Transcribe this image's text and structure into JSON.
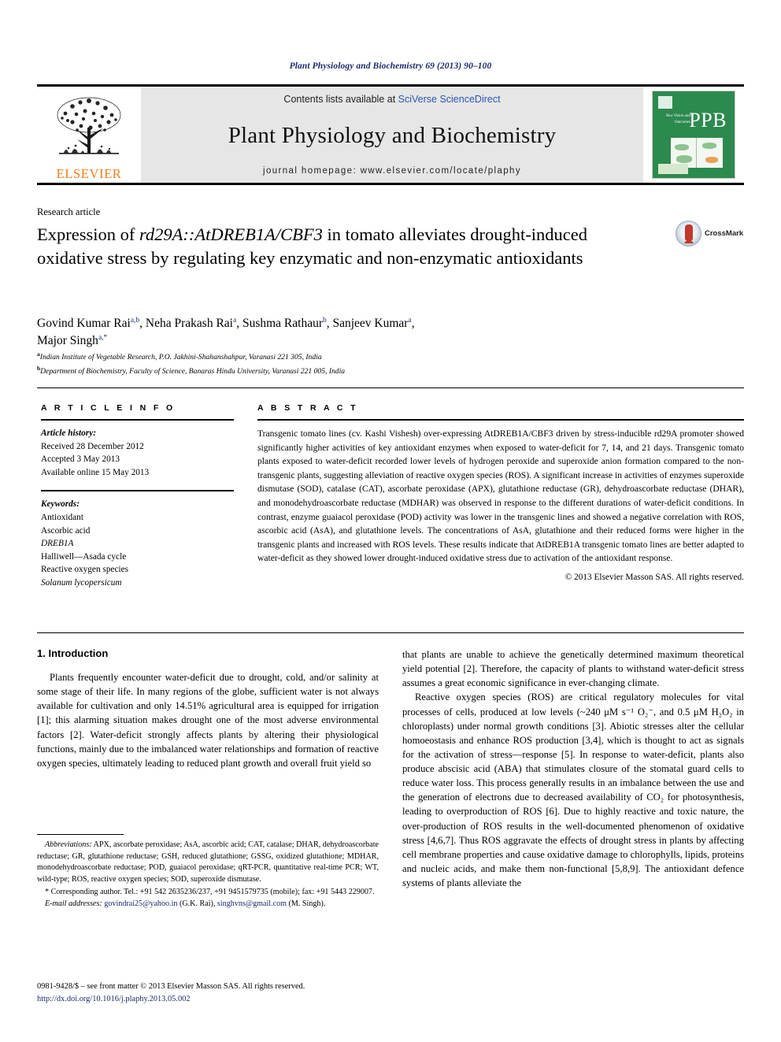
{
  "running_head": "Plant Physiology and Biochemistry 69 (2013) 90–100",
  "masthead": {
    "publisher_name": "ELSEVIER",
    "contents_prefix": "Contents lists available at ",
    "contents_link": "SciVerse ScienceDirect",
    "journal_title": "Plant Physiology and Biochemistry",
    "homepage_line": "journal homepage: www.elsevier.com/locate/plaphy",
    "cover_abbrev": "PPB",
    "cover_tagline": "New Vision and Outcomes"
  },
  "article": {
    "section_type": "Research article",
    "title_parts": [
      {
        "text": "Expression of ",
        "italic": false
      },
      {
        "text": "rd29A::AtDREB1A/CBF3",
        "italic": true
      },
      {
        "text": " in tomato alleviates drought-induced oxidative stress by regulating key enzymatic and non-enzymatic antioxidants",
        "italic": false
      }
    ],
    "title_plain": "Expression of rd29A::AtDREB1A/CBF3 in tomato alleviates drought-induced oxidative stress by regulating key enzymatic and non-enzymatic antioxidants",
    "crossmark_label": "CrossMark",
    "authors": [
      {
        "name": "Govind Kumar Rai",
        "sup": "a,b",
        "sep": ", "
      },
      {
        "name": "Neha Prakash Rai",
        "sup": "a",
        "sep": ", "
      },
      {
        "name": "Sushma Rathaur",
        "sup": "b",
        "sep": ", "
      },
      {
        "name": "Sanjeev Kumar",
        "sup": "a",
        "sep": ","
      },
      {
        "name": "Major Singh",
        "sup": "a,*",
        "sep": ""
      }
    ],
    "affiliations": [
      {
        "marker": "a",
        "text": "Indian Institute of Vegetable Research, P.O. Jakhini-Shahanshahpur, Varanasi 221 305, India"
      },
      {
        "marker": "b",
        "text": "Department of Biochemistry, Faculty of Science, Banaras Hindu University, Varanasi 221 005, India"
      }
    ]
  },
  "article_info": {
    "heading": "A R T I C L E  I N F O",
    "history_label": "Article history:",
    "history": [
      "Received 28 December 2012",
      "Accepted 3 May 2013",
      "Available online 15 May 2013"
    ],
    "keywords_label": "Keywords:",
    "keywords": [
      {
        "text": "Antioxidant",
        "italic": false
      },
      {
        "text": "Ascorbic acid",
        "italic": false
      },
      {
        "text": "DREB1A",
        "italic": true
      },
      {
        "text": "Halliwell—Asada cycle",
        "italic": false
      },
      {
        "text": "Reactive oxygen species",
        "italic": false
      },
      {
        "text": "Solanum lycopersicum",
        "italic": true
      }
    ]
  },
  "abstract": {
    "heading": "A B S T R A C T",
    "text": "Transgenic tomato lines (cv. Kashi Vishesh) over-expressing AtDREB1A/CBF3 driven by stress-inducible rd29A promoter showed significantly higher activities of key antioxidant enzymes when exposed to water-deficit for 7, 14, and 21 days. Transgenic tomato plants exposed to water-deficit recorded lower levels of hydrogen peroxide and superoxide anion formation compared to the non-transgenic plants, suggesting alleviation of reactive oxygen species (ROS). A significant increase in activities of enzymes superoxide dismutase (SOD), catalase (CAT), ascorbate peroxidase (APX), glutathione reductase (GR), dehydroascorbate reductase (DHAR), and monodehydroascorbate reductase (MDHAR) was observed in response to the different durations of water-deficit conditions. In contrast, enzyme guaiacol peroxidase (POD) activity was lower in the transgenic lines and showed a negative correlation with ROS, ascorbic acid (AsA), and glutathione levels. The concentrations of AsA, glutathione and their reduced forms were higher in the transgenic plants and increased with ROS levels. These results indicate that AtDREB1A transgenic tomato lines are better adapted to water-deficit as they showed lower drought-induced oxidative stress due to activation of the antioxidant response.",
    "copyright": "© 2013 Elsevier Masson SAS. All rights reserved."
  },
  "introduction": {
    "heading": "1.  Introduction",
    "left_p1": "Plants frequently encounter water-deficit due to drought, cold, and/or salinity at some stage of their life. In many regions of the globe, sufficient water is not always available for cultivation and only 14.51% agricultural area is equipped for irrigation [1]; this alarming situation makes drought one of the most adverse environmental factors [2]. Water-deficit strongly affects plants by altering their physiological functions, mainly due to the imbalanced water relationships and formation of reactive oxygen species, ultimately leading to reduced plant growth and overall fruit yield so",
    "right_p1": "that plants are unable to achieve the genetically determined maximum theoretical yield potential [2]. Therefore, the capacity of plants to withstand water-deficit stress assumes a great economic significance in ever-changing climate.",
    "right_p2": "Reactive oxygen species (ROS) are critical regulatory molecules for vital processes of cells, produced at low levels (~240 μM s⁻¹ O₂⁻, and 0.5 μM H₂O₂ in chloroplasts) under normal growth conditions [3]. Abiotic stresses alter the cellular homoeostasis and enhance ROS production [3,4], which is thought to act as signals for the activation of stress—response [5]. In response to water-deficit, plants also produce abscisic acid (ABA) that stimulates closure of the stomatal guard cells to reduce water loss. This process generally results in an imbalance between the use and the generation of electrons due to decreased availability of CO₂ for photosynthesis, leading to overproduction of ROS [6]. Due to highly reactive and toxic nature, the over-production of ROS results in the well-documented phenomenon of oxidative stress [4,6,7]. Thus ROS aggravate the effects of drought stress in plants by affecting cell membrane properties and cause oxidative damage to chlorophylls, lipids, proteins and nucleic acids, and make them non-functional [5,8,9]. The antioxidant defence systems of plants alleviate the"
  },
  "footnotes": {
    "abbreviations_label": "Abbreviations:",
    "abbreviations_text": " APX, ascorbate peroxidase; AsA, ascorbic acid; CAT, catalase; DHAR, dehydroascorbate reductase; GR, glutathione reductase; GSH, reduced glutathione; GSSG, oxidized glutathione; MDHAR, monodehydroascorbate reductase; POD, guaiacol peroxidase; qRT-PCR, quantitative real-time PCR; WT, wild-type; ROS, reactive oxygen species; SOD, superoxide dismutase.",
    "corresponding_text": "* Corresponding author. Tel.: +91 542 2635236/237, +91 9451579735 (mobile); fax: +91 5443 229007.",
    "email_label": "E-mail addresses:",
    "email_1": "govindrai25@yahoo.in",
    "email_1_owner": " (G.K. Rai), ",
    "email_2": "singhvns@gmail.com",
    "email_2_owner": " (M. Singh)."
  },
  "page_footer": {
    "issn_line": "0981-9428/$ – see front matter © 2013 Elsevier Masson SAS. All rights reserved.",
    "doi": "http://dx.doi.org/10.1016/j.plaphy.2013.05.002"
  },
  "colors": {
    "link_blue": "#2b56b5",
    "ref_blue": "#1a2a6c",
    "elsevier_orange": "#f07c1a",
    "cover_green": "#2c8a4e"
  }
}
